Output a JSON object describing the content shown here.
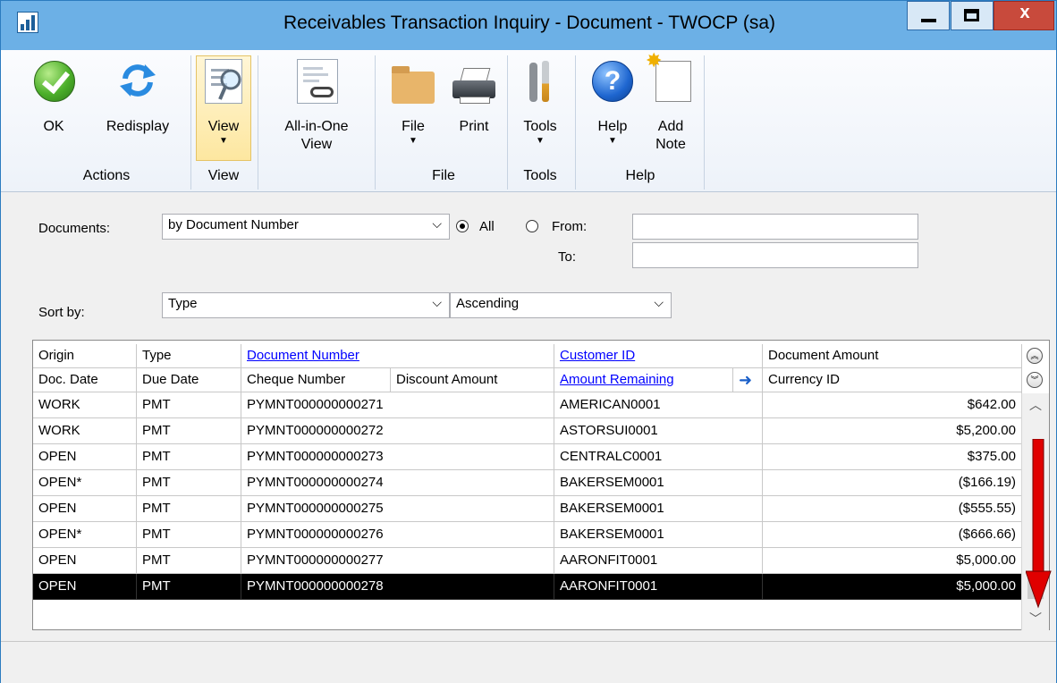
{
  "window": {
    "title": "Receivables Transaction Inquiry - Document  -  TWOCP (sa)",
    "minimize_glyph": "",
    "close_glyph": "x"
  },
  "ribbon": {
    "ok": "OK",
    "redisplay": "Redisplay",
    "view": "View",
    "all_in_one_view_1": "All-in-One",
    "all_in_one_view_2": "View",
    "file": "File",
    "print": "Print",
    "tools": "Tools",
    "help": "Help",
    "add_note_1": "Add",
    "add_note_2": "Note",
    "groups": {
      "actions": "Actions",
      "view": "View",
      "file": "File",
      "tools": "Tools",
      "help": "Help"
    }
  },
  "filters": {
    "documents_label": "Documents:",
    "documents_value": "by Document Number",
    "all_label": "All",
    "from_label": "From:",
    "to_label": "To:",
    "from_value": "",
    "to_value": "",
    "sort_label": "Sort by:",
    "sort_value": "Type",
    "order_value": "Ascending"
  },
  "grid": {
    "header1": [
      "Origin",
      "Type",
      "Document Number",
      "Customer ID",
      "Document Amount"
    ],
    "header2": [
      "Doc. Date",
      "Due Date",
      "Cheque Number",
      "Discount Amount",
      "Amount Remaining",
      "Currency ID"
    ],
    "rows": [
      {
        "origin": "WORK",
        "type": "PMT",
        "doc": "PYMNT000000000271",
        "cust": "AMERICAN0001",
        "amount": "$642.00"
      },
      {
        "origin": "WORK",
        "type": "PMT",
        "doc": "PYMNT000000000272",
        "cust": "ASTORSUI0001",
        "amount": "$5,200.00"
      },
      {
        "origin": "OPEN",
        "type": "PMT",
        "doc": "PYMNT000000000273",
        "cust": "CENTRALC0001",
        "amount": "$375.00"
      },
      {
        "origin": "OPEN*",
        "type": "PMT",
        "doc": "PYMNT000000000274",
        "cust": "BAKERSEM0001",
        "amount": "($166.19)"
      },
      {
        "origin": "OPEN",
        "type": "PMT",
        "doc": "PYMNT000000000275",
        "cust": "BAKERSEM0001",
        "amount": "($555.55)"
      },
      {
        "origin": "OPEN*",
        "type": "PMT",
        "doc": "PYMNT000000000276",
        "cust": "BAKERSEM0001",
        "amount": "($666.66)"
      },
      {
        "origin": "OPEN",
        "type": "PMT",
        "doc": "PYMNT000000000277",
        "cust": "AARONFIT0001",
        "amount": "$5,000.00"
      },
      {
        "origin": "OPEN",
        "type": "PMT",
        "doc": "PYMNT000000000278",
        "cust": "AARONFIT0001",
        "amount": "$5,000.00"
      }
    ],
    "selected_row": 7
  },
  "icons": {
    "ok": "check-circle-icon",
    "redisplay": "refresh-arrows-icon",
    "view": "magnifier-document-icon",
    "all_in_one": "linked-document-icon",
    "file": "folder-icon",
    "print": "printer-icon",
    "tools": "tools-icon",
    "help": "question-circle-icon",
    "add_note": "note-star-icon"
  },
  "colors": {
    "title_bar": "#6cb0e6",
    "selected_row": "#000000",
    "link": "#0000ff",
    "annotation_arrow": "#e00000"
  }
}
